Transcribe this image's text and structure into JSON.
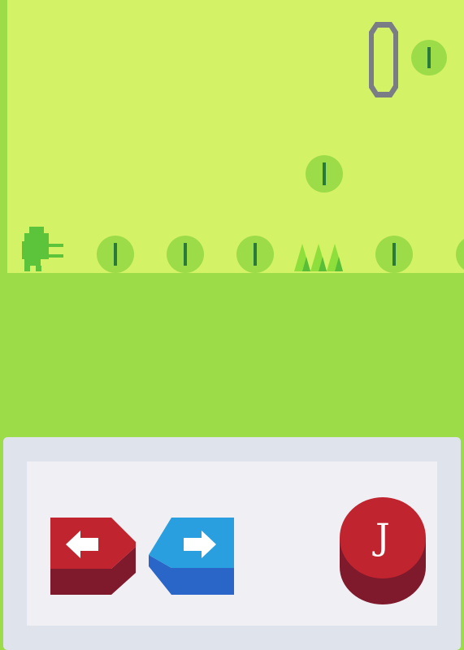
{
  "game": {
    "colors": {
      "sky": "#d4f266",
      "ground": "#9cdc48",
      "coin_fill": "#9cdc48",
      "coin_slot": "#2a7a3c",
      "player": "#5cc43a",
      "spike_light": "#8fdf3c",
      "spike_dark": "#58be38",
      "portal_frame": "#7a7c86",
      "panel_outer": "#dfe3ec",
      "panel_inner": "#efeff4",
      "left_button": "#c0242e",
      "right_button": "#2a9fe0",
      "jump_button": "#c0242e"
    },
    "coins_visible": 7,
    "spike_count": 3
  },
  "controls": {
    "left": {
      "icon": "arrow-left-icon"
    },
    "right": {
      "icon": "arrow-right-icon"
    },
    "jump": {
      "label": "J"
    }
  }
}
